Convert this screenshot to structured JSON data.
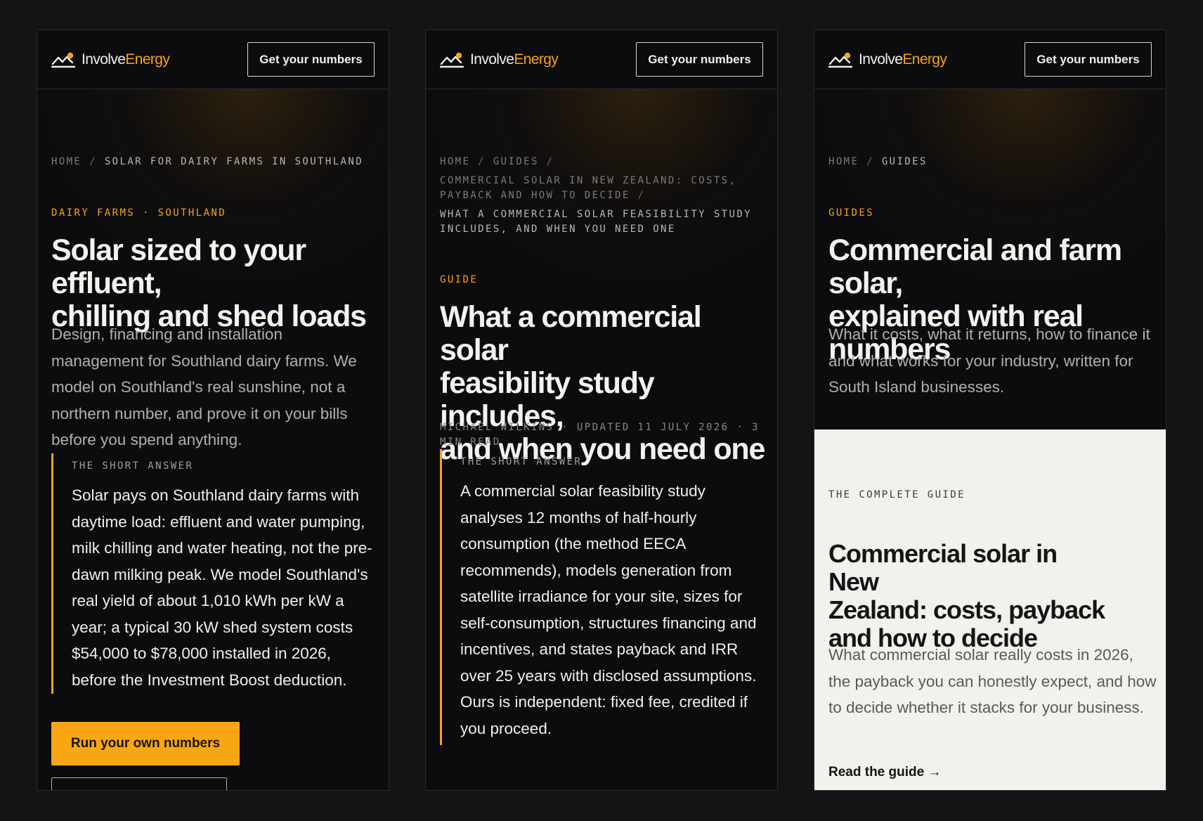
{
  "colors": {
    "accent": "#f5a21c",
    "background": "#141416",
    "panel": "#0c0c0e",
    "light_card": "#f3f1ed"
  },
  "brand": {
    "name_a": "Involve",
    "name_b": "Energy",
    "icon": "mountain-sun-icon"
  },
  "header": {
    "cta_label": "Get your numbers"
  },
  "panels": [
    {
      "breadcrumb": {
        "home": "HOME",
        "current": "SOLAR FOR DAIRY FARMS IN SOUTHLAND"
      },
      "eyebrow": "DAIRY FARMS · SOUTHLAND",
      "title_line1": "Solar sized to your effluent,",
      "title_line2": "chilling and shed loads",
      "lede": "Design, financing and installation management for Southland dairy farms. We model on Southland's real sunshine, not a northern number, and prove it on your bills before you spend anything.",
      "answer_label": "THE SHORT ANSWER",
      "answer_text": "Solar pays on Southland dairy farms with daytime load: effluent and water pumping, milk chilling and water heating, not the pre-dawn milking peak. We model Southland's real yield of about 1,010 kWh per kW a year; a typical 30 kW shed system costs $54,000 to $78,000 installed in 2026, before the Investment Boost deduction.",
      "cta_label": "Run your own numbers"
    },
    {
      "breadcrumb": {
        "home": "HOME",
        "guides": "GUIDES",
        "parent_line1": "COMMERCIAL SOLAR IN NEW ZEALAND: COSTS,",
        "parent_line2": "PAYBACK AND HOW TO DECIDE",
        "current_line1": "WHAT A COMMERCIAL SOLAR FEASIBILITY STUDY",
        "current_line2": "INCLUDES, AND WHEN YOU NEED ONE"
      },
      "eyebrow": "GUIDE",
      "title_line1": "What a commercial solar",
      "title_line2": "feasibility study includes,",
      "title_line3": "and when you need one",
      "byline_line1": "MICHAEL WILKINS · UPDATED 11 JULY 2026 · 3",
      "byline_line2": "MIN READ",
      "answer_label": "THE SHORT ANSWER",
      "answer_text": "A commercial solar feasibility study analyses 12 months of half-hourly consumption (the method EECA recommends), models generation from satellite irradiance for your site, sizes for self-consumption, structures financing and incentives, and states payback and IRR over 25 years with disclosed assumptions. Ours is independent: fixed fee, credited if you proceed."
    },
    {
      "breadcrumb": {
        "home": "HOME",
        "current": "GUIDES"
      },
      "eyebrow": "GUIDES",
      "title_line1": "Commercial and farm solar,",
      "title_line2": "explained with real numbers",
      "lede": "What it costs, what it returns, how to finance it and what works for your industry, written for South Island businesses.",
      "card": {
        "label": "THE COMPLETE GUIDE",
        "title_line1": "Commercial solar in New",
        "title_line2": "Zealand: costs, payback",
        "title_line3": "and how to decide",
        "desc": "What commercial solar really costs in 2026, the payback you can honestly expect, and how to decide whether it stacks for your business.",
        "link": "Read the guide →"
      }
    }
  ]
}
